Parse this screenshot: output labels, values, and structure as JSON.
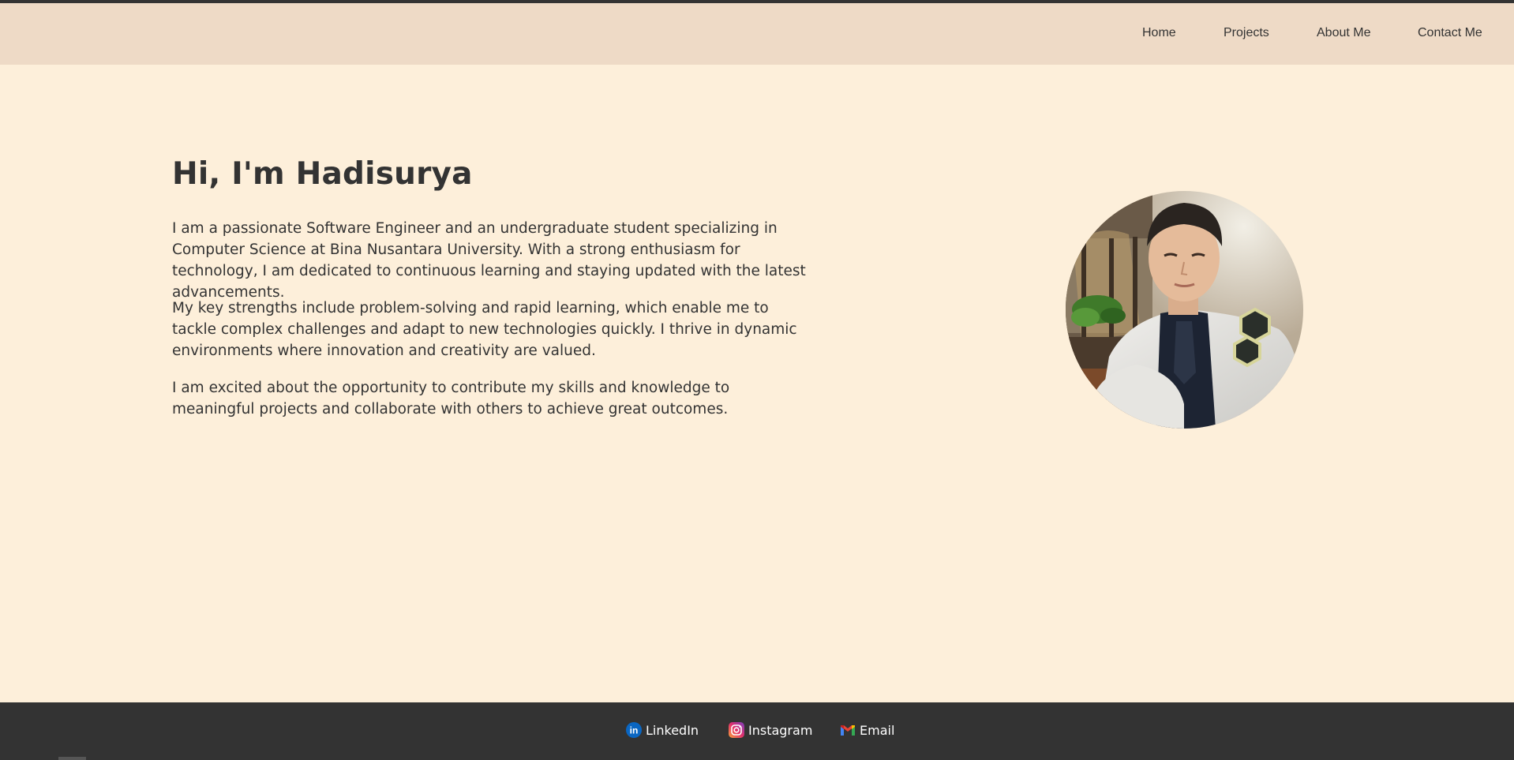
{
  "nav": {
    "items": [
      {
        "label": "Home"
      },
      {
        "label": "Projects"
      },
      {
        "label": "About Me"
      },
      {
        "label": "Contact Me"
      }
    ]
  },
  "hero": {
    "title": "Hi, I'm Hadisurya",
    "paragraphs": [
      "I am a passionate Software Engineer and an undergraduate student specializing in Computer Science at Bina Nusantara University. With a strong enthusiasm for technology, I am dedicated to continuous learning and staying updated with the latest advancements.",
      "My key strengths include problem-solving and rapid learning, which enable me to tackle complex challenges and adapt to new technologies quickly. I thrive in dynamic environments where innovation and creativity are valued.",
      "I am excited about the opportunity to contribute my skills and knowledge to meaningful projects and collaborate with others to achieve great outcomes."
    ]
  },
  "footer": {
    "links": [
      {
        "label": "LinkedIn",
        "icon": "linkedin-icon"
      },
      {
        "label": "Instagram",
        "icon": "instagram-icon"
      },
      {
        "label": "Email",
        "icon": "gmail-icon"
      }
    ]
  },
  "colors": {
    "page_background": "#fdefda",
    "navbar_background": "#eedac6",
    "footer_background": "#333333",
    "text": "#333333"
  }
}
